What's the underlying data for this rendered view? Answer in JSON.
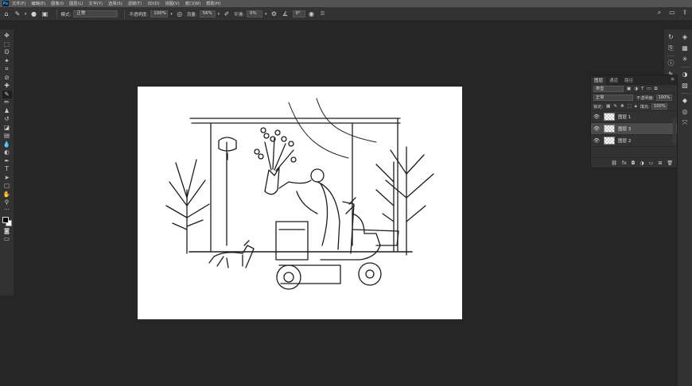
{
  "menubar": {
    "app_icon": "Ps",
    "items": [
      "文件(F)",
      "编辑(E)",
      "图像(I)",
      "图层(L)",
      "文字(Y)",
      "选择(S)",
      "滤镜(T)",
      "3D(D)",
      "视图(V)",
      "窗口(W)",
      "帮助(H)"
    ]
  },
  "options": {
    "mode_label": "模式:",
    "mode_value": "正常",
    "opacity_label": "不透明度:",
    "opacity_value": "100%",
    "flow_label": "流量:",
    "flow_value": "56%",
    "smooth_label": "平滑:",
    "smooth_value": "0%",
    "angle_value": "0°"
  },
  "layers_panel": {
    "tabs": [
      "图层",
      "通道",
      "路径"
    ],
    "filter_value": "类型",
    "blend_mode": "正常",
    "opacity_label": "不透明度:",
    "opacity_value": "100%",
    "lock_label": "锁定:",
    "fill_label": "填充:",
    "fill_value": "100%",
    "layers": [
      {
        "name": "图层 1",
        "selected": false
      },
      {
        "name": "图层 3",
        "selected": true
      },
      {
        "name": "图层 2",
        "selected": false
      }
    ],
    "footer_icons": [
      "link-icon",
      "fx-icon",
      "mask-icon",
      "adjustment-icon",
      "group-icon",
      "new-layer-icon",
      "delete-icon"
    ]
  },
  "colors": {
    "workspace": "#262626",
    "panel": "#323232",
    "menubar": "#535353",
    "canvas": "#ffffff"
  }
}
